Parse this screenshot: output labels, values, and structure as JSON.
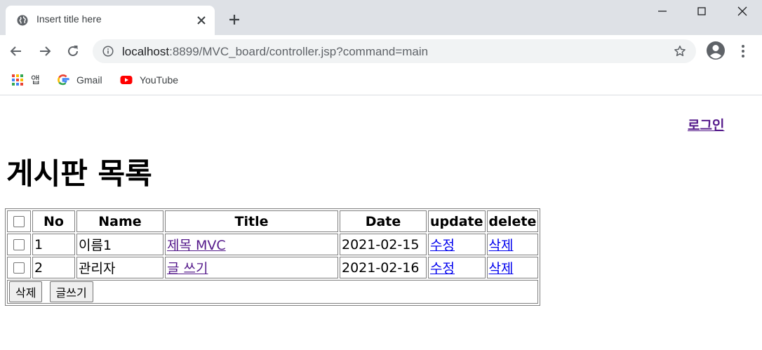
{
  "browser": {
    "tab": {
      "title": "Insert title here"
    },
    "address": {
      "host": "localhost",
      "rest": ":8899/MVC_board/controller.jsp?command=main"
    },
    "bookmarks": [
      {
        "label": "앱",
        "icon": "apps-grid-icon"
      },
      {
        "label": "Gmail",
        "icon": "google-icon"
      },
      {
        "label": "YouTube",
        "icon": "youtube-icon"
      }
    ]
  },
  "page": {
    "login_label": "로그인",
    "title": "게시판 목록",
    "table": {
      "headers": {
        "no": "No",
        "name": "Name",
        "title": "Title",
        "date": "Date",
        "update": "update",
        "delete": "delete"
      },
      "rows": [
        {
          "no": "1",
          "name": "이름1",
          "title": "제목 MVC",
          "date": "2021-02-15",
          "update": "수정",
          "delete": "삭제"
        },
        {
          "no": "2",
          "name": "관리자",
          "title": "글 쓰기",
          "date": "2021-02-16",
          "update": "수정",
          "delete": "삭제"
        }
      ],
      "buttons": {
        "delete": "삭제",
        "write": "글쓰기"
      }
    }
  }
}
